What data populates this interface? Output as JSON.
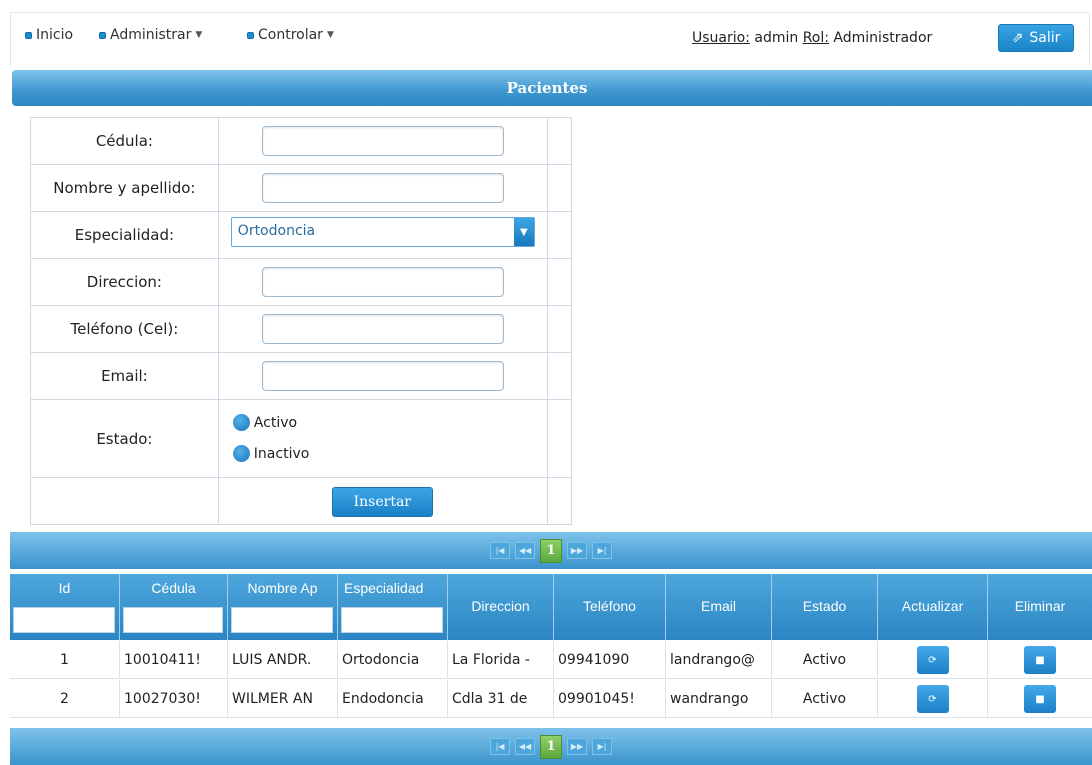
{
  "menu": {
    "items": [
      {
        "label": "Inicio",
        "has_dropdown": false
      },
      {
        "label": "Administrar",
        "has_dropdown": true
      },
      {
        "label": "Controlar",
        "has_dropdown": true
      }
    ],
    "user_label": "Usuario:",
    "user_name": " admin ",
    "rol_label": "Rol:",
    "rol_value": " Administrador",
    "logout_label": "Salir"
  },
  "panel": {
    "title": "Pacientes"
  },
  "form": {
    "cedula_label": "Cédula:",
    "nombre_label": "Nombre y apellido:",
    "especialidad_label": "Especialidad:",
    "especialidad_value": "Ortodoncia",
    "direccion_label": "Direccion:",
    "telefono_label": "Teléfono (Cel):",
    "email_label": "Email:",
    "estado_label": "Estado:",
    "estado_options": [
      "Activo",
      "Inactivo"
    ],
    "insert_label": "Insertar"
  },
  "pager": {
    "current_page": "1"
  },
  "grid": {
    "columns": [
      "Id",
      "Cédula",
      "Nombre Ap",
      "Especialidad",
      "Direccion",
      "Teléfono",
      "Email",
      "Estado",
      "Actualizar",
      "Eliminar"
    ],
    "rows": [
      {
        "id": "1",
        "cedula": "10010411!",
        "nombre": "LUIS ANDR.",
        "especialidad": "Ortodoncia",
        "direccion": "La Florida -",
        "telefono": "09941090",
        "email": "landrango@",
        "estado": "Activo"
      },
      {
        "id": "2",
        "cedula": "10027030!",
        "nombre": "WILMER AN",
        "especialidad": "Endodoncia",
        "direccion": "Cdla 31 de",
        "telefono": "09901045!",
        "email": "wandrango",
        "estado": "Activo"
      }
    ]
  },
  "colors": {
    "accent": "#1c8fd0",
    "header_gradient_top": "#7fc3ec",
    "header_gradient_bottom": "#2d87c1",
    "page_active": "#5aa83b"
  },
  "icons": {
    "menu_bullet": "square-bullet-icon",
    "logout": "logout-icon",
    "dropdown": "chevron-down-icon",
    "update": "refresh-icon",
    "delete": "trash-icon"
  }
}
